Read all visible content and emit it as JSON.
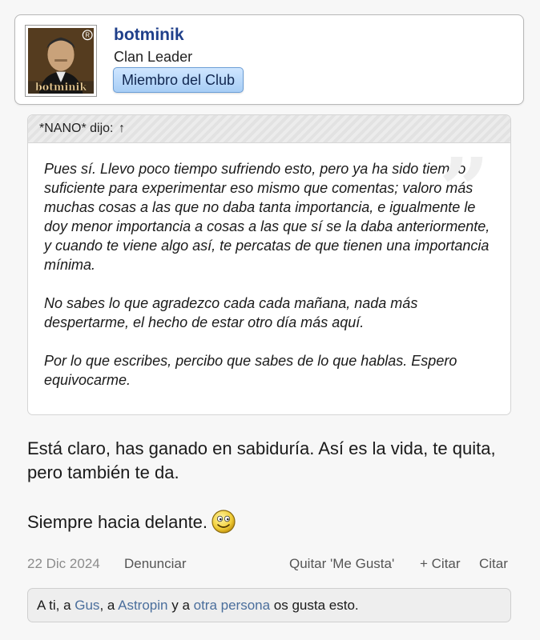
{
  "author": {
    "username": "botminik",
    "title": "Clan Leader",
    "badge": "Miembro del Club",
    "avatar_caption": "botminik",
    "avatar_mark": "R"
  },
  "quote": {
    "attribution": "*NANO* dijo:",
    "jump_icon": "↑",
    "paragraphs": [
      "Pues sí. Llevo poco tiempo sufriendo esto, pero ya ha sido tiempo suficiente para experimentar eso mismo que comentas; valoro más muchas cosas a las que no daba tanta importancia, e igualmente le doy menor importancia a cosas a las que sí se la daba anteriormente, y cuando te viene algo así, te percatas de que tienen una importancia mínima.",
      "No sabes lo que agradezco cada cada mañana, nada más despertarme, el hecho de estar otro día más aquí.",
      "Por lo que escribes, percibo que sabes de lo que hablas. Espero equivocarme."
    ]
  },
  "message": {
    "paragraph_1": "Está claro, has ganado en sabiduría. Así es la vida, te quita, pero también te da.",
    "paragraph_2": "Siempre hacia delante.",
    "emoji": "smile-emoji"
  },
  "footer": {
    "date": "22 Dic 2024",
    "report": "Denunciar",
    "unlike": "Quitar 'Me Gusta'",
    "multiquote": "+ Citar",
    "quote": "Citar"
  },
  "likes": {
    "prefix": "A ti, a ",
    "user_1": "Gus",
    "sep_1": ", a ",
    "user_2": "Astropin",
    "sep_2": " y a ",
    "others": "otra persona",
    "suffix": " os gusta esto."
  },
  "colors": {
    "username": "#1f3f8a",
    "badge_bg": "#a7cdf5",
    "link": "#4a6e9c",
    "muted": "#8c8c8c"
  }
}
